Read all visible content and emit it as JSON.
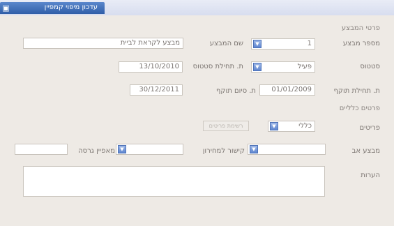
{
  "window": {
    "title": "עדכון מיפוי קמפיין",
    "app_icon": "app-window-icon"
  },
  "form": {
    "section_campaign": "פרטי המבצע",
    "campaign_number": {
      "label": "מספר מבצע",
      "value": "1"
    },
    "campaign_name": {
      "label": "שם המבצע",
      "value": "מבצע לקראת לביית"
    },
    "status": {
      "label": "סטטוס",
      "value": "פעיל"
    },
    "start_date": {
      "label": "ת. תחילת סטטוס",
      "value": "13/10/2010"
    },
    "valid_start": {
      "label": "ת. תחילת תוקף",
      "value": "01/01/2009"
    },
    "valid_end": {
      "label": "ת. סיום תוקף",
      "value": "30/12/2011"
    },
    "section_general": "פרטים כלליים",
    "items": {
      "label": "פריטים",
      "value": "כללי",
      "button": "רשימת פריטים"
    },
    "parent_campaign": {
      "label": "מבצע אב",
      "value": ""
    },
    "link_type": {
      "label": "קישור למחירון",
      "value": ""
    },
    "version": {
      "label": "מאפיין גרסה",
      "value": ""
    },
    "version_extra": {
      "value": ""
    },
    "notes": {
      "label": "הערות",
      "value": ""
    }
  }
}
